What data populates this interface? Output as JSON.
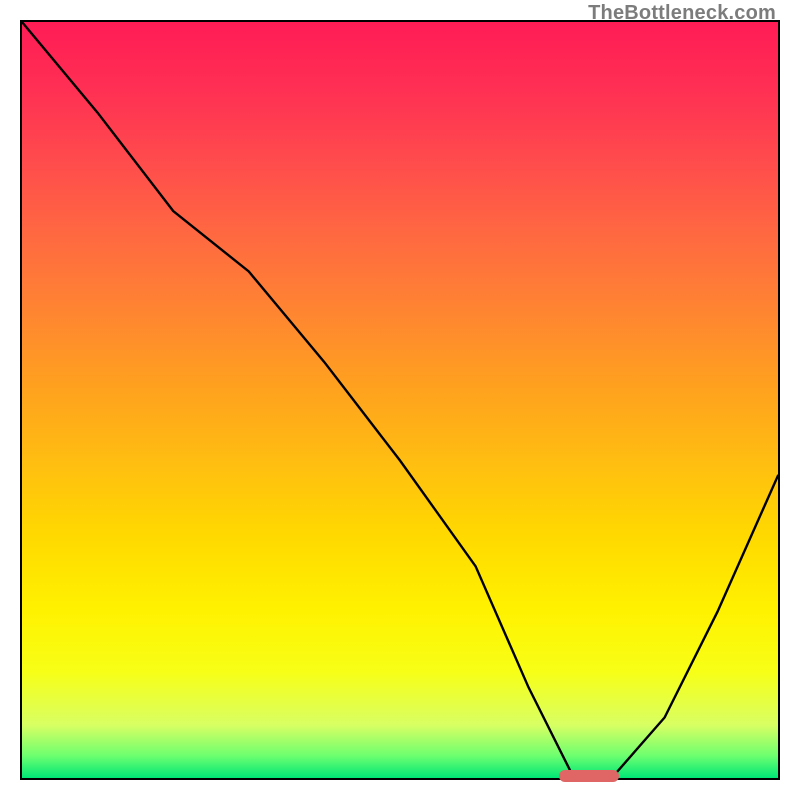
{
  "watermark": "TheBottleneck.com",
  "chart_data": {
    "type": "line",
    "title": "",
    "xlabel": "",
    "ylabel": "",
    "xlim": [
      0,
      100
    ],
    "ylim": [
      0,
      100
    ],
    "x": [
      0,
      10,
      20,
      30,
      40,
      50,
      60,
      67,
      73,
      78,
      85,
      92,
      100
    ],
    "values": [
      100,
      88,
      75,
      67,
      55,
      42,
      28,
      12,
      0,
      0,
      8,
      22,
      40
    ],
    "marker": {
      "x_start": 71,
      "x_end": 79,
      "y": 0,
      "color": "#e06666"
    },
    "gradient_stops": [
      {
        "pct": 0,
        "color": "#ff1c55"
      },
      {
        "pct": 50,
        "color": "#ffa01f"
      },
      {
        "pct": 80,
        "color": "#fff200"
      },
      {
        "pct": 100,
        "color": "#00e676"
      }
    ]
  }
}
